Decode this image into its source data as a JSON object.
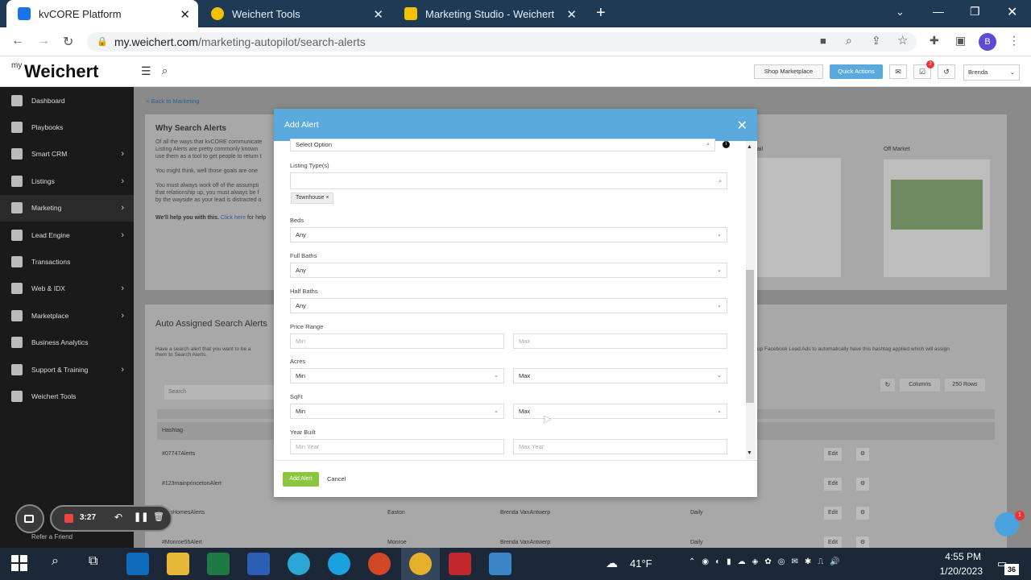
{
  "browser": {
    "tabs": [
      {
        "title": "kvCORE Platform",
        "active": true,
        "color": "#1a73e8"
      },
      {
        "title": "Weichert Tools",
        "active": false,
        "color": "#f2c200"
      },
      {
        "title": "Marketing Studio - Weichert",
        "active": false,
        "color": "#f2c200"
      }
    ],
    "url_host": "my.weichert.com",
    "url_path": "/marketing-autopilot/search-alerts",
    "profile_initial": "B",
    "new_tab": "+"
  },
  "app": {
    "logo_my": "my",
    "logo_brand": "Weichert",
    "shop_marketplace": "Shop Marketplace",
    "quick_actions": "Quick Actions",
    "notif_count": "2",
    "user_name": "Brenda"
  },
  "sidebar": {
    "items": [
      {
        "label": "Dashboard",
        "icon": "dashboard-icon",
        "chevron": false
      },
      {
        "label": "Playbooks",
        "icon": "playbook-icon",
        "chevron": false
      },
      {
        "label": "Smart CRM",
        "icon": "crm-icon",
        "chevron": true
      },
      {
        "label": "Listings",
        "icon": "home-icon",
        "chevron": true
      },
      {
        "label": "Marketing",
        "icon": "send-icon",
        "chevron": true
      },
      {
        "label": "Lead Engine",
        "icon": "lead-icon",
        "chevron": true
      },
      {
        "label": "Transactions",
        "icon": "transactions-icon",
        "chevron": false
      },
      {
        "label": "Web & IDX",
        "icon": "web-icon",
        "chevron": true
      },
      {
        "label": "Marketplace",
        "icon": "marketplace-icon",
        "chevron": true
      },
      {
        "label": "Business Analytics",
        "icon": "analytics-icon",
        "chevron": false
      },
      {
        "label": "Support & Training",
        "icon": "support-icon",
        "chevron": true
      },
      {
        "label": "Weichert Tools",
        "icon": "tools-icon",
        "chevron": false
      }
    ],
    "refer": "Refer a Friend"
  },
  "background": {
    "back_link": "< Back to Marketing",
    "why_title": "Why Search Alerts",
    "why_text_1": "Of all the ways that kvCORE communicate",
    "why_text_2": "Listing Alerts are pretty commonly known",
    "why_text_3": "use them as a tool to get people to return t",
    "why_text_4": "You might think, well those goals are one",
    "why_text_5": "You must always work off of the assumpti",
    "why_text_6": "that relationship up, you must always be f",
    "why_text_7": "by the wayside as your lead is distracted o",
    "help_prefix": "We'll help you with this.",
    "help_link": "Click here",
    "help_suffix": "for help",
    "email_label": "ail",
    "off_market": "Off Market",
    "auto_title": "Auto Assigned Search Alerts",
    "auto_desc_1": "Have a search alert that you want to be a",
    "auto_desc_2": "them to Search Alerts.",
    "auto_desc_right": "up Facebook Lead Ads to automatically have this hashtag applied which will assign",
    "search_placeholder": "Search",
    "columns_btn": "Columns",
    "rows_btn": "250 Rows",
    "col_header": "Hashtag",
    "rows": [
      {
        "tag": "#07747Alerts",
        "city": "",
        "agent": "",
        "freq": ""
      },
      {
        "tag": "#123mainprincetonAlert",
        "city": "",
        "agent": "",
        "freq": ""
      },
      {
        "tag": "stonHomesAlerts",
        "city": "Easton",
        "agent": "Brenda VanAntwerp",
        "freq": "Daily"
      },
      {
        "tag": "#Monroe55Alert",
        "city": "Monroe",
        "agent": "Brenda VanAntwerp",
        "freq": "Daily"
      }
    ],
    "edit_label": "Edit"
  },
  "modal": {
    "title": "Add Alert",
    "select_option": "Select Option",
    "listing_type_label": "Listing Type(s)",
    "tag_townhouse": "Townhouse",
    "beds_label": "Beds",
    "beds_value": "Any",
    "full_baths_label": "Full Baths",
    "full_baths_value": "Any",
    "half_baths_label": "Half Baths",
    "half_baths_value": "Any",
    "price_label": "Price Range",
    "price_min_ph": "Min",
    "price_max_ph": "Max",
    "acres_label": "Acres",
    "acres_min": "Min",
    "acres_max": "Max",
    "sqft_label": "SqFt",
    "sqft_min": "Min",
    "sqft_max": "Max",
    "year_label": "Year Built",
    "year_min_ph": "Min Year",
    "year_max_ph": "Max Year",
    "add_button": "Add Alert",
    "cancel_button": "Cancel"
  },
  "recorder": {
    "time": "3:27"
  },
  "taskbar": {
    "weather": "41°F",
    "time": "4:55 PM",
    "date": "1/20/2023",
    "notif_count": "36",
    "chat_badge": "1"
  },
  "colors": {
    "accent": "#5aa9dd",
    "add_button": "#8cc63f",
    "sidebar": "#1a1a1a"
  }
}
